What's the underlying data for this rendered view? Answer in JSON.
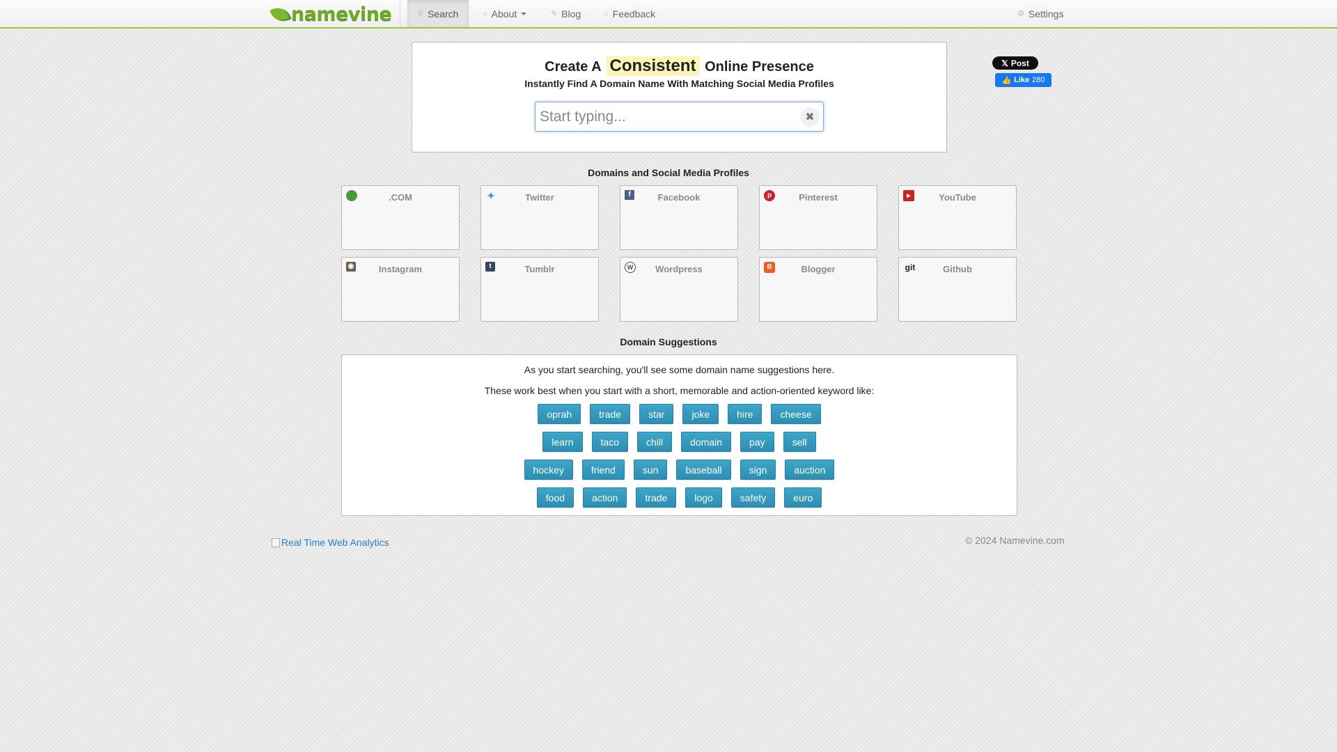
{
  "nav": {
    "logo_text": "namevine",
    "items": [
      {
        "label": "Search",
        "icon": "search-icon"
      },
      {
        "label": "About",
        "icon": "info-icon"
      },
      {
        "label": "Blog",
        "icon": "pencil-icon"
      },
      {
        "label": "Feedback",
        "icon": "chat-icon"
      }
    ],
    "settings_label": "Settings"
  },
  "hero": {
    "title_prefix": "Create A",
    "title_highlight": "Consistent",
    "title_suffix": "Online Presence",
    "subtitle": "Instantly Find A Domain Name With Matching Social Media Profiles",
    "search_placeholder": "Start typing...",
    "search_value": ""
  },
  "social_share": {
    "x_label": "Post",
    "fb_label": "Like",
    "fb_count": "280"
  },
  "profiles_heading": "Domains and Social Media Profiles",
  "profiles": [
    {
      "label": ".COM",
      "icon": "globe-icon",
      "color": "#4a9a3a"
    },
    {
      "label": "Twitter",
      "icon": "twitter-icon",
      "color": "#3aa0d8"
    },
    {
      "label": "Facebook",
      "icon": "facebook-icon",
      "color": "#4a5f8a"
    },
    {
      "label": "Pinterest",
      "icon": "pinterest-icon",
      "color": "#cb2027"
    },
    {
      "label": "YouTube",
      "icon": "youtube-icon",
      "color": "#cc2222"
    },
    {
      "label": "Instagram",
      "icon": "instagram-icon",
      "color": "#6b5b4b"
    },
    {
      "label": "Tumblr",
      "icon": "tumblr-icon",
      "color": "#36465d"
    },
    {
      "label": "Wordpress",
      "icon": "wordpress-icon",
      "color": "#464646"
    },
    {
      "label": "Blogger",
      "icon": "blogger-icon",
      "color": "#f15a24"
    },
    {
      "label": "Github",
      "icon": "github-icon",
      "color": "#222222"
    }
  ],
  "suggestions_heading": "Domain Suggestions",
  "suggestions": {
    "line1": "As you start searching, you'll see some domain name suggestions here.",
    "line2": "These work best when you start with a short, memorable and action-oriented keyword like:",
    "keyword_rows": [
      [
        "oprah",
        "trade",
        "star",
        "joke",
        "hire",
        "cheese"
      ],
      [
        "learn",
        "taco",
        "chill",
        "domain",
        "pay",
        "sell"
      ],
      [
        "hockey",
        "friend",
        "sun",
        "baseball",
        "sign",
        "auction"
      ],
      [
        "food",
        "action",
        "trade",
        "logo",
        "safety",
        "euro"
      ]
    ]
  },
  "footer": {
    "analytics_link": "Real Time Web Analytics",
    "copyright": "© 2024 Namevine.com"
  },
  "colors": {
    "accent_green": "#9bc53d",
    "keyword_blue": "#3ea6c8",
    "link_blue": "#2b7fc2",
    "highlight_yellow": "#fbf5b8"
  }
}
